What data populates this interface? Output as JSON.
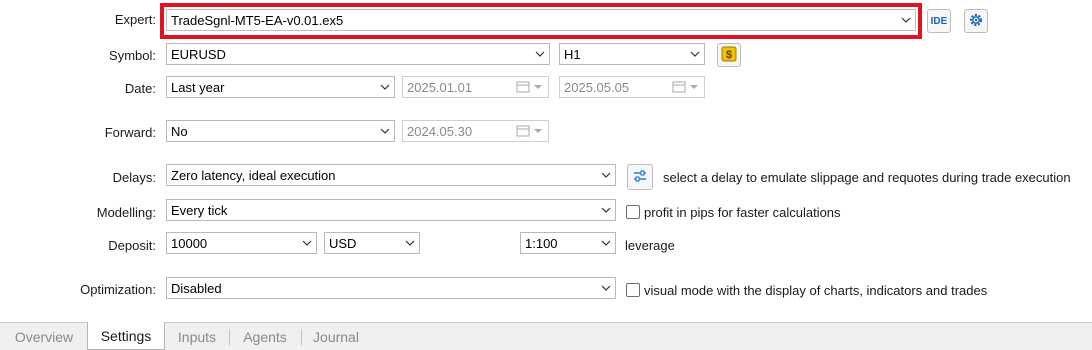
{
  "expert": {
    "label": "Expert:",
    "value": "TradeSgnl-MT5-EA-v0.01.ex5",
    "ide_label": "IDE"
  },
  "symbol": {
    "label": "Symbol:",
    "value": "EURUSD",
    "timeframe": "H1"
  },
  "date": {
    "label": "Date:",
    "value": "Last year",
    "from": "2025.01.01",
    "to": "2025.05.05"
  },
  "forward": {
    "label": "Forward:",
    "value": "No",
    "date": "2024.05.30"
  },
  "delays": {
    "label": "Delays:",
    "value": "Zero latency, ideal execution",
    "hint": "select a delay to emulate slippage and requotes during trade execution"
  },
  "modelling": {
    "label": "Modelling:",
    "value": "Every tick",
    "checkbox_label": "profit in pips for faster calculations",
    "checked": false
  },
  "deposit": {
    "label": "Deposit:",
    "value": "10000",
    "currency": "USD",
    "leverage_value": "1:100",
    "leverage_label": "leverage"
  },
  "optimization": {
    "label": "Optimization:",
    "value": "Disabled",
    "checkbox_label": "visual mode with the display of charts, indicators and trades",
    "checked": false
  },
  "tabs": [
    {
      "label": "Overview"
    },
    {
      "label": "Settings"
    },
    {
      "label": "Inputs"
    },
    {
      "label": "Agents"
    },
    {
      "label": "Journal"
    }
  ],
  "active_tab": "Settings",
  "colors": {
    "highlight": "#e0141e",
    "accent": "#1565c0",
    "coin": "#f2c200"
  }
}
